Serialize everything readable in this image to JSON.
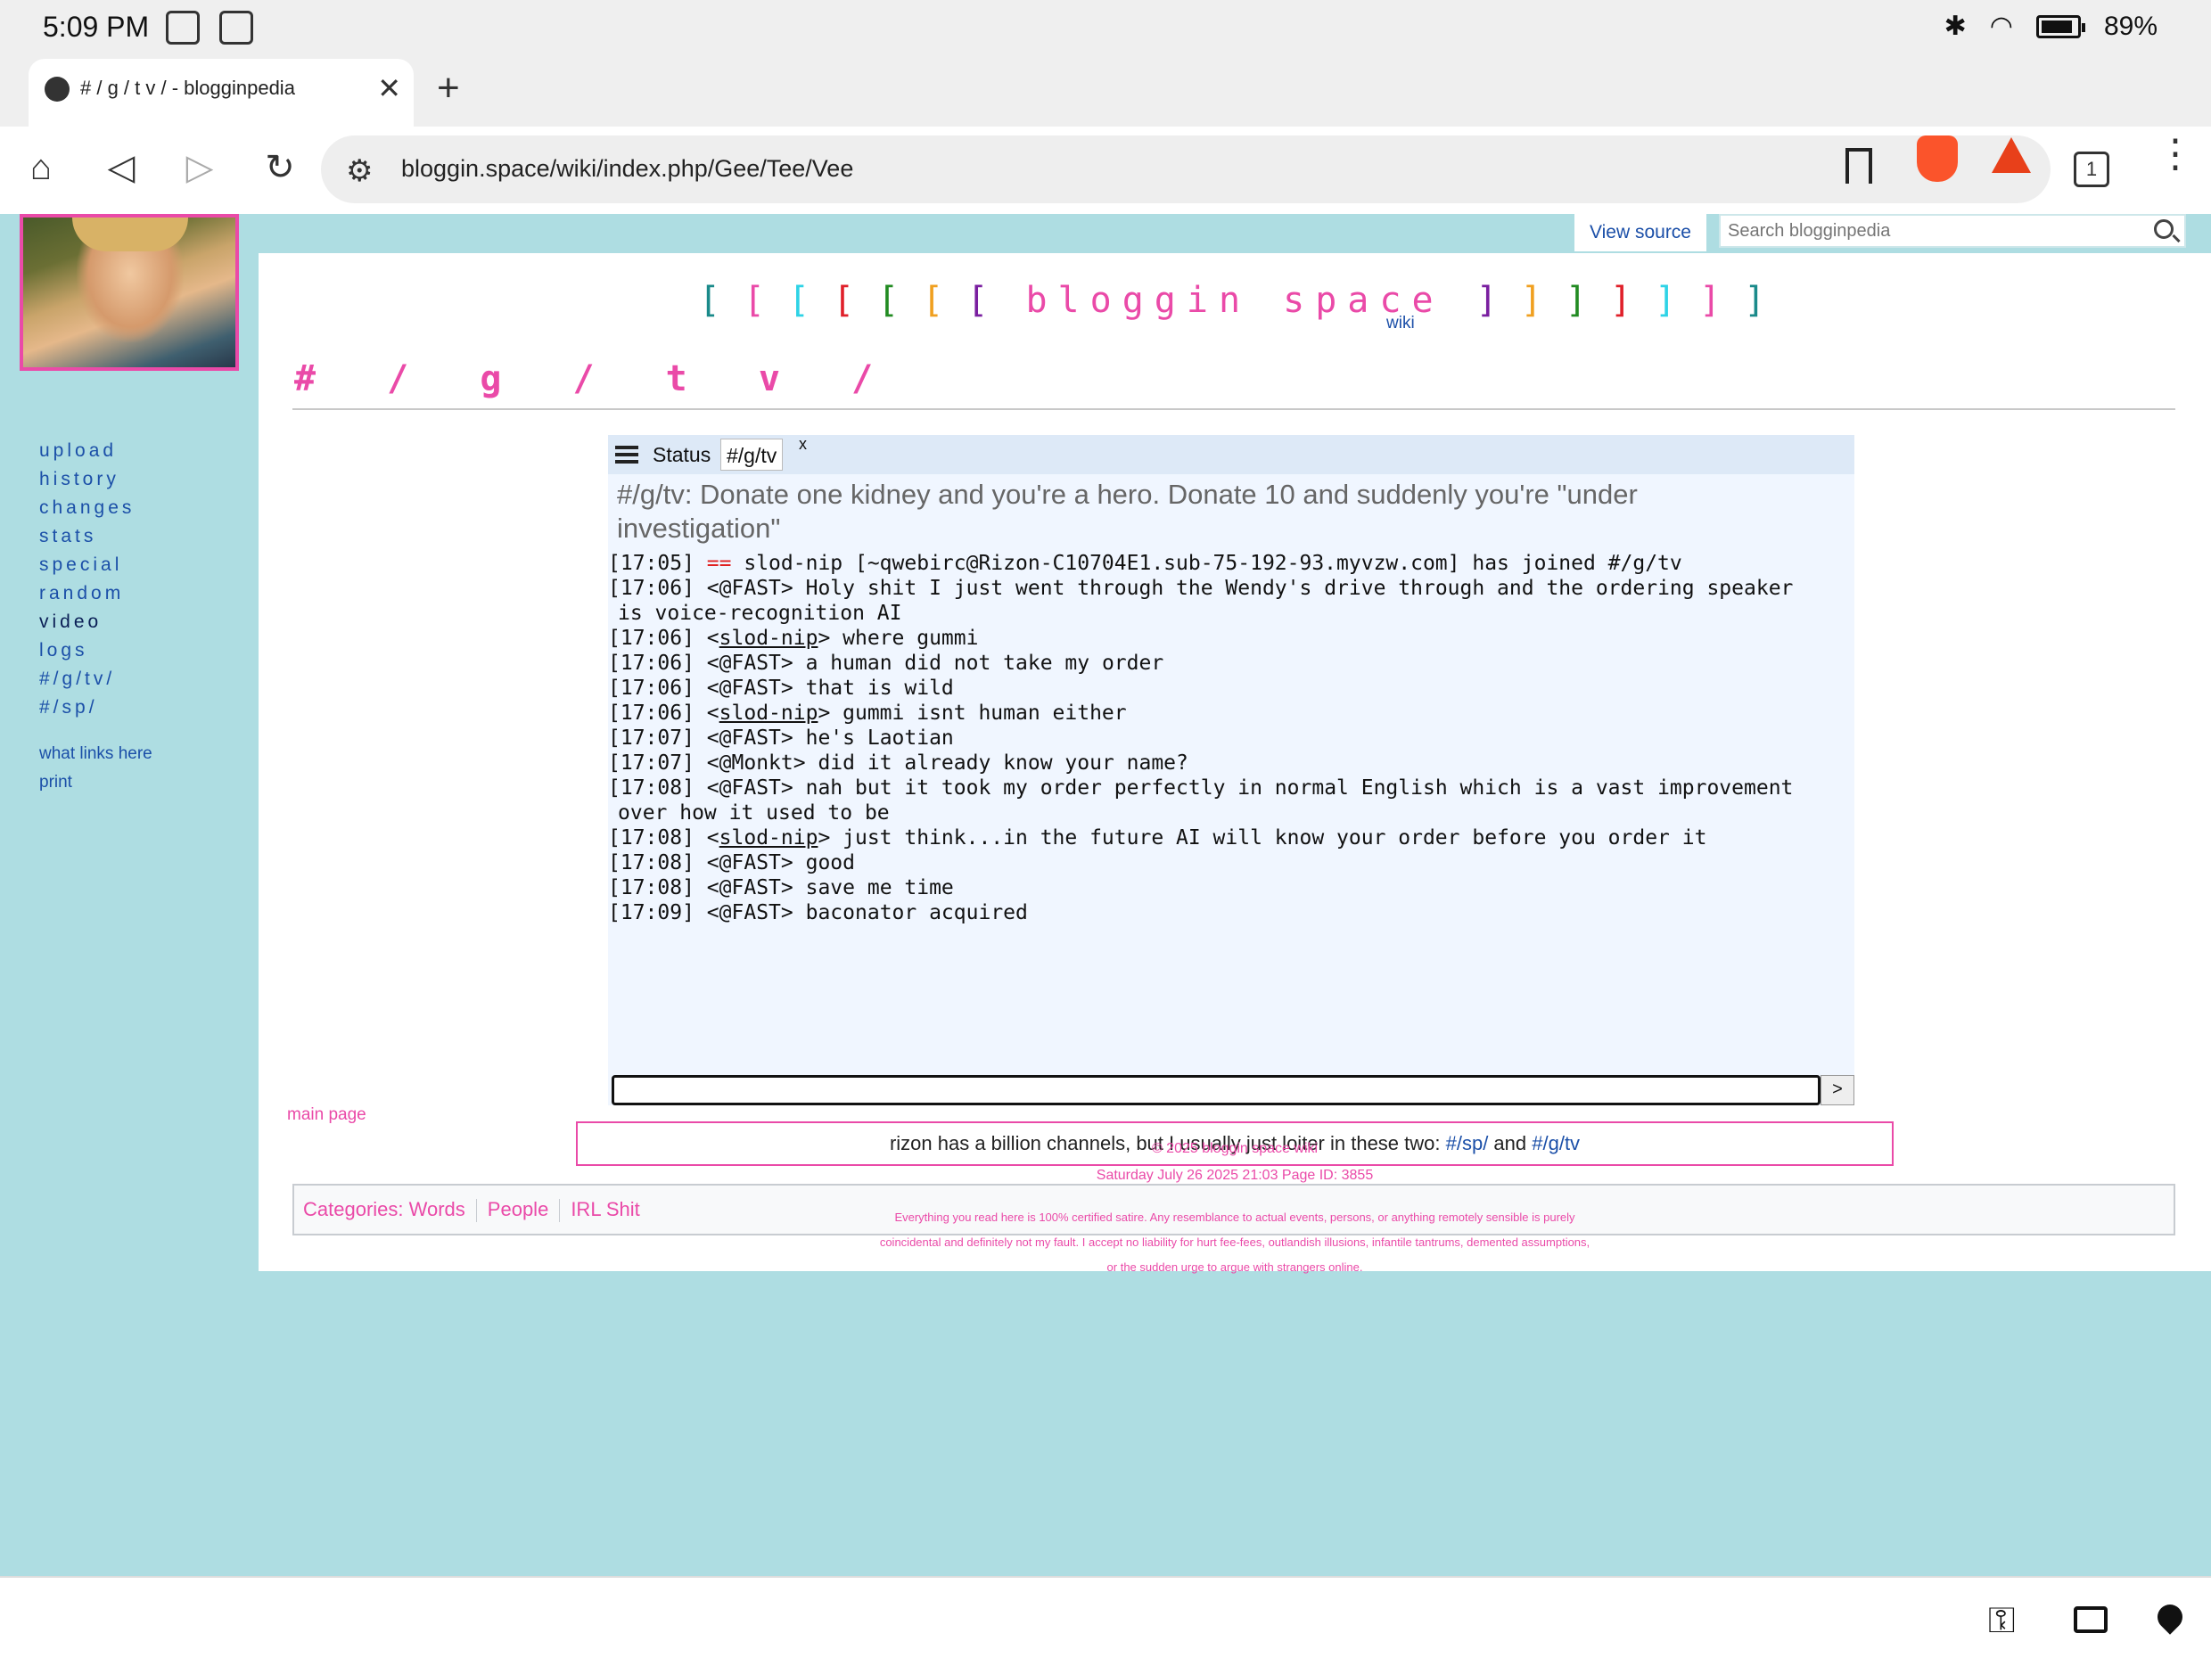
{
  "status_bar": {
    "time": "5:09 PM",
    "battery": "89%"
  },
  "browser": {
    "tab_title": "# / g / t v / - blogginpedia",
    "url": "bloggin.space/wiki/index.php/Gee/Tee/Vee",
    "tab_count": "1"
  },
  "wiki": {
    "view_source": "View source",
    "search_placeholder": "Search blogginpedia",
    "logo": {
      "name": "bloggin space",
      "wiki": "wiki",
      "left_brackets": [
        {
          "ch": "[",
          "color": "#1a8a8a"
        },
        {
          "ch": "[",
          "color": "#ea4aa8"
        },
        {
          "ch": "[",
          "color": "#2ed3e6"
        },
        {
          "ch": "[",
          "color": "#e0202a"
        },
        {
          "ch": "[",
          "color": "#228b22"
        },
        {
          "ch": "[",
          "color": "#f0a020"
        },
        {
          "ch": "[",
          "color": "#7a1fa0"
        }
      ],
      "right_brackets": [
        {
          "ch": "]",
          "color": "#7a1fa0"
        },
        {
          "ch": "]",
          "color": "#f0a020"
        },
        {
          "ch": "]",
          "color": "#228b22"
        },
        {
          "ch": "]",
          "color": "#e0202a"
        },
        {
          "ch": "]",
          "color": "#2ed3e6"
        },
        {
          "ch": "]",
          "color": "#ea4aa8"
        },
        {
          "ch": "]",
          "color": "#1a8a8a"
        }
      ]
    },
    "page_title": "# / g / t v /",
    "nav": [
      "upload",
      "history",
      "changes",
      "stats",
      "special",
      "random",
      "video",
      "logs",
      "#/g/tv/",
      "#/sp/"
    ],
    "tools": [
      "what links here",
      "print"
    ]
  },
  "irc": {
    "tabs": {
      "status": "Status",
      "channel": "#/g/tv",
      "close": "x"
    },
    "topic": "#/g/tv: Donate one kidney and you're a hero. Donate 10 and suddenly you're \"under investigation\"",
    "send": ">",
    "messages": [
      {
        "time": "[17:05]",
        "kind": "join",
        "eq": "==",
        "text": "slod-nip [~qwebirc@Rizon-C10704E1.sub-75-192-93.myvzw.com] has joined #/g/tv"
      },
      {
        "time": "[17:06]",
        "kind": "msg",
        "nick": "@FAST",
        "link": false,
        "text": "Holy shit I just went through the Wendy's drive through and the ordering speaker",
        "wrap": "is voice-recognition AI"
      },
      {
        "time": "[17:06]",
        "kind": "msg",
        "nick": "slod-nip",
        "link": true,
        "text": "where gummi"
      },
      {
        "time": "[17:06]",
        "kind": "msg",
        "nick": "@FAST",
        "link": false,
        "text": "a human did not take my order"
      },
      {
        "time": "[17:06]",
        "kind": "msg",
        "nick": "@FAST",
        "link": false,
        "text": "that is wild"
      },
      {
        "time": "[17:06]",
        "kind": "msg",
        "nick": "slod-nip",
        "link": true,
        "text": "gummi isnt human either"
      },
      {
        "time": "[17:07]",
        "kind": "msg",
        "nick": "@FAST",
        "link": false,
        "text": "he's Laotian"
      },
      {
        "time": "[17:07]",
        "kind": "msg",
        "nick": "@Monkt",
        "link": false,
        "text": "did it already know your name?"
      },
      {
        "time": "[17:08]",
        "kind": "msg",
        "nick": "@FAST",
        "link": false,
        "text": "nah but it took my order perfectly in normal English which is a vast improvement",
        "wrap": "over how it used to be"
      },
      {
        "time": "[17:08]",
        "kind": "msg",
        "nick": "slod-nip",
        "link": true,
        "text": "just think...in the future AI will know your order before you order it"
      },
      {
        "time": "[17:08]",
        "kind": "msg",
        "nick": "@FAST",
        "link": false,
        "text": "good"
      },
      {
        "time": "[17:08]",
        "kind": "msg",
        "nick": "@FAST",
        "link": false,
        "text": "save me time"
      },
      {
        "time": "[17:09]",
        "kind": "msg",
        "nick": "@FAST",
        "link": false,
        "text": "baconator acquired"
      }
    ]
  },
  "note": {
    "text": "rizon has a billion channels, but I usually just loiter in these two: ",
    "link1": "#/sp/",
    "and": " and ",
    "link2": "#/g/tv"
  },
  "categories": {
    "label": "Categories",
    "items": [
      "Words",
      "People",
      "IRL Shit"
    ]
  },
  "footer": {
    "main_page": "main page",
    "copyright": "© 2025 bloggin space wiki",
    "date": "Saturday July 26 2025 21:03 Page ID: 3855",
    "disclaimer": [
      "Everything you read here is 100% certified satire. Any resemblance to actual events, persons, or anything remotely sensible is purely",
      "coincidental and definitely not my fault. I accept no liability for hurt fee-fees, outlandish illusions, infantile tantrums, demented assumptions,",
      "or the sudden urge to argue with strangers online."
    ]
  }
}
